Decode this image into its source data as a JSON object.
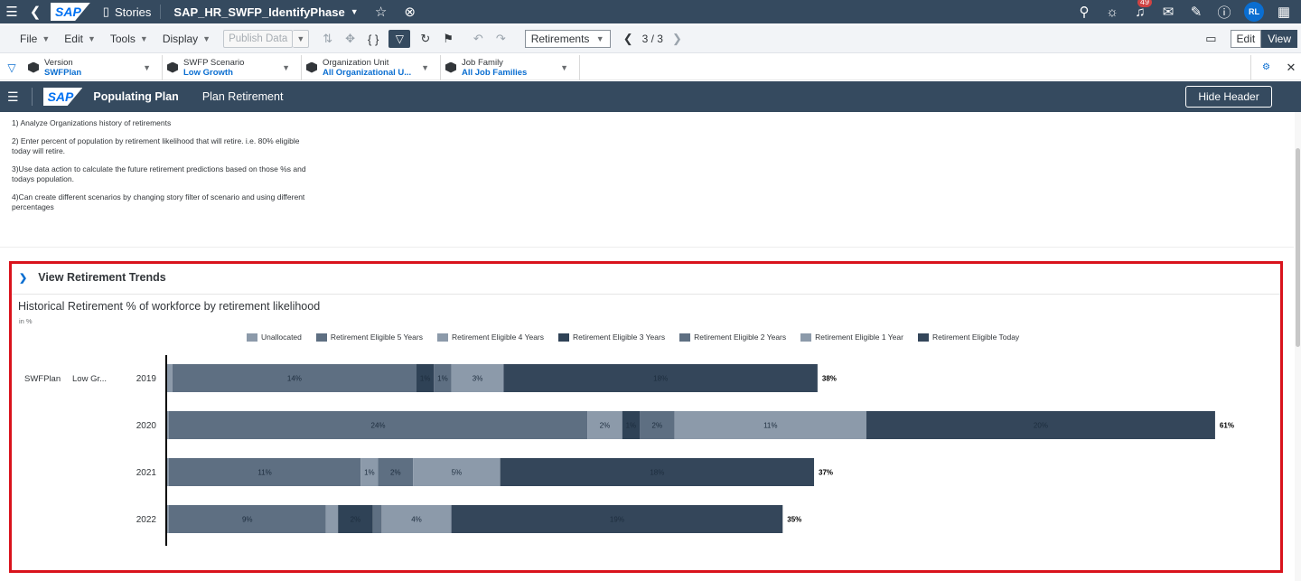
{
  "shell": {
    "stories_label": "Stories",
    "story_title": "SAP_HR_SWFP_IdentifyPhase",
    "notification_count": "49",
    "avatar_initials": "RL"
  },
  "toolbar": {
    "menus": [
      "File",
      "Edit",
      "Tools",
      "Display"
    ],
    "publish_label": "Publish Data",
    "page_select": "Retirements",
    "pager": "3 / 3",
    "edit_label": "Edit",
    "view_label": "View"
  },
  "filters": [
    {
      "label": "Version",
      "value": "SWFPlan"
    },
    {
      "label": "SWFP Scenario",
      "value": "Low Growth"
    },
    {
      "label": "Organization Unit",
      "value": "All Organizational U..."
    },
    {
      "label": "Job Family",
      "value": "All Job Families"
    }
  ],
  "app_header": {
    "title": "Populating Plan",
    "tab": "Plan Retirement",
    "hide_header_label": "Hide Header"
  },
  "notes": [
    "1) Analyze Organizations history of retirements",
    "2) Enter percent of population by retirement likelihood that will retire. i.e. 80% eligible today will retire.",
    "3)Use data action to calculate the future retirement predictions based on those %s and todays population.",
    "4)Can create different scenarios by changing story filter of scenario and using different percentages"
  ],
  "section": {
    "title": "View Retirement Trends"
  },
  "colors": {
    "Unallocated": "#8c9aaa",
    "Retirement Eligible 5 Years": "#5e6f82",
    "Retirement Eligible 4 Years": "#8c9aaa",
    "Retirement Eligible 3 Years": "#2f4256",
    "Retirement Eligible 2 Years": "#5e6f82",
    "Retirement Eligible 1 Year": "#8c9aaa",
    "Retirement Eligible Today": "#34465a"
  },
  "chart_data": {
    "type": "bar",
    "orientation": "horizontal",
    "stacked": true,
    "title": "Historical Retirement % of workforce by retirement likelihood",
    "unit": "in %",
    "legend_position": "top",
    "row_labels": {
      "version": "SWFPlan",
      "scenario": "Low Gr..."
    },
    "categories": [
      "2019",
      "2020",
      "2021",
      "2022"
    ],
    "series": [
      {
        "name": "Unallocated",
        "values": [
          0.3,
          0.1,
          0.1,
          0.1
        ]
      },
      {
        "name": "Retirement Eligible 5 Years",
        "values": [
          14,
          24,
          11,
          9
        ]
      },
      {
        "name": "Retirement Eligible 4 Years",
        "values": [
          0,
          2,
          1,
          0.7
        ]
      },
      {
        "name": "Retirement Eligible 3 Years",
        "values": [
          1,
          1,
          0,
          2
        ]
      },
      {
        "name": "Retirement Eligible 2 Years",
        "values": [
          1,
          2,
          2,
          0.5
        ]
      },
      {
        "name": "Retirement Eligible 1 Year",
        "values": [
          3,
          11,
          5,
          4
        ]
      },
      {
        "name": "Retirement Eligible Today",
        "values": [
          18,
          20,
          18,
          19
        ]
      }
    ],
    "segment_labels": [
      [
        "",
        "14%",
        "",
        "1%",
        "1%",
        "3%",
        "18%"
      ],
      [
        "",
        "24%",
        "2%",
        "1%",
        "2%",
        "11%",
        "20%"
      ],
      [
        "",
        "11%",
        "1%",
        "",
        "2%",
        "5%",
        "18%"
      ],
      [
        "",
        "9%",
        "",
        "2%",
        "",
        "4%",
        "19%"
      ]
    ],
    "totals": [
      "38%",
      "61%",
      "37%",
      "35%"
    ]
  }
}
